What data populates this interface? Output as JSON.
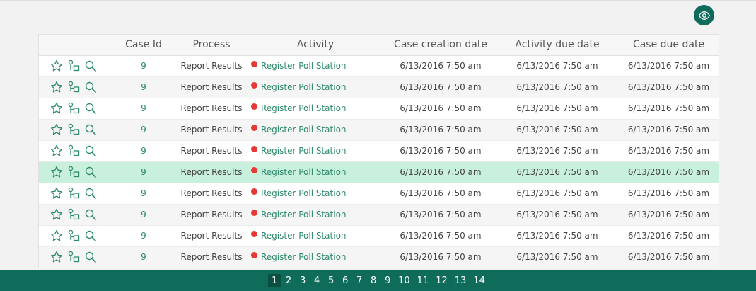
{
  "colors": {
    "accent": "#0f6b5a",
    "link_green": "#2e8b6e",
    "selected_row": "#c9f0dd",
    "status_dot": "#e53935"
  },
  "toolbar": {
    "visibility_icon": "eye-icon"
  },
  "table": {
    "columns": [
      "",
      "Case Id",
      "Process",
      "Activity",
      "Case creation date",
      "Activity due date",
      "Case due date"
    ],
    "row_icons": [
      "star-icon",
      "diagram-icon",
      "search-icon"
    ],
    "selected_row_index": 5,
    "rows": [
      {
        "case_id": "9",
        "process": "Report Results",
        "activity": "Register Poll Station",
        "case_creation": "6/13/2016 7:50 am",
        "activity_due": "6/13/2016 7:50 am",
        "case_due": "6/13/2016 7:50 am"
      },
      {
        "case_id": "9",
        "process": "Report Results",
        "activity": "Register Poll Station",
        "case_creation": "6/13/2016 7:50 am",
        "activity_due": "6/13/2016 7:50 am",
        "case_due": "6/13/2016 7:50 am"
      },
      {
        "case_id": "9",
        "process": "Report Results",
        "activity": "Register Poll Station",
        "case_creation": "6/13/2016 7:50 am",
        "activity_due": "6/13/2016 7:50 am",
        "case_due": "6/13/2016 7:50 am"
      },
      {
        "case_id": "9",
        "process": "Report Results",
        "activity": "Register Poll Station",
        "case_creation": "6/13/2016 7:50 am",
        "activity_due": "6/13/2016 7:50 am",
        "case_due": "6/13/2016 7:50 am"
      },
      {
        "case_id": "9",
        "process": "Report Results",
        "activity": "Register Poll Station",
        "case_creation": "6/13/2016 7:50 am",
        "activity_due": "6/13/2016 7:50 am",
        "case_due": "6/13/2016 7:50 am"
      },
      {
        "case_id": "9",
        "process": "Report Results",
        "activity": "Register Poll Station",
        "case_creation": "6/13/2016 7:50 am",
        "activity_due": "6/13/2016 7:50 am",
        "case_due": "6/13/2016 7:50 am"
      },
      {
        "case_id": "9",
        "process": "Report Results",
        "activity": "Register Poll Station",
        "case_creation": "6/13/2016 7:50 am",
        "activity_due": "6/13/2016 7:50 am",
        "case_due": "6/13/2016 7:50 am"
      },
      {
        "case_id": "9",
        "process": "Report Results",
        "activity": "Register Poll Station",
        "case_creation": "6/13/2016 7:50 am",
        "activity_due": "6/13/2016 7:50 am",
        "case_due": "6/13/2016 7:50 am"
      },
      {
        "case_id": "9",
        "process": "Report Results",
        "activity": "Register Poll Station",
        "case_creation": "6/13/2016 7:50 am",
        "activity_due": "6/13/2016 7:50 am",
        "case_due": "6/13/2016 7:50 am"
      },
      {
        "case_id": "9",
        "process": "Report Results",
        "activity": "Register Poll Station",
        "case_creation": "6/13/2016 7:50 am",
        "activity_due": "6/13/2016 7:50 am",
        "case_due": "6/13/2016 7:50 am"
      }
    ]
  },
  "pagination": {
    "current": "1",
    "pages": [
      "1",
      "2",
      "3",
      "4",
      "5",
      "6",
      "7",
      "8",
      "9",
      "10",
      "11",
      "12",
      "13",
      "14"
    ]
  }
}
